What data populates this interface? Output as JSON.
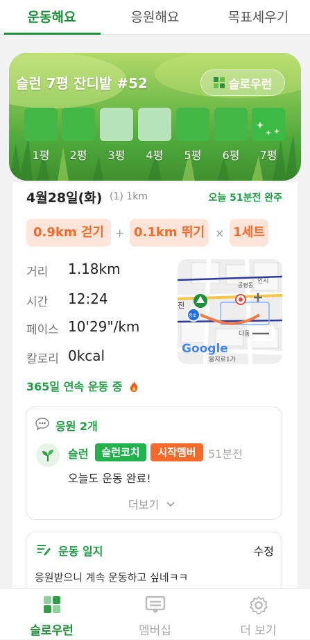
{
  "tabs": [
    {
      "label": "운동해요",
      "active": true
    },
    {
      "label": "응원해요",
      "active": false
    },
    {
      "label": "목표세우기",
      "active": false
    }
  ],
  "banner": {
    "title": "슬런 7평 잔디밭 #52",
    "brand": "슬로우런",
    "pyeong": [
      {
        "label": "1평",
        "state": "done"
      },
      {
        "label": "2평",
        "state": "done"
      },
      {
        "label": "3평",
        "state": "light"
      },
      {
        "label": "4평",
        "state": "light"
      },
      {
        "label": "5평",
        "state": "done"
      },
      {
        "label": "6평",
        "state": "done"
      },
      {
        "label": "7평",
        "state": "sparkle"
      }
    ]
  },
  "workout": {
    "date": "4월28일(화)",
    "subtitle": "(1) 1km",
    "status": "오늘 51분전 완주",
    "plan": {
      "walk": "0.9km 걷기",
      "plus": "+",
      "run": "0.1km 뛰기",
      "times": "×",
      "sets": "1세트"
    },
    "stats": [
      {
        "label": "거리",
        "value": "1.18km"
      },
      {
        "label": "시간",
        "value": "12:24"
      },
      {
        "label": "페이스",
        "value": "10'29\"/km"
      },
      {
        "label": "칼로리",
        "value": "0kcal"
      }
    ],
    "map": {
      "labels": [
        "인시",
        "공평동",
        "천",
        "다동",
        "을지로1가",
        "종로",
        "Google"
      ]
    },
    "streak": "365일 연속 운동 중"
  },
  "cheers": {
    "title": "응원 2개",
    "items": [
      {
        "name": "슬런",
        "badges": [
          "슬런코치",
          "시작멤버"
        ],
        "time": "51분전",
        "text": "오늘도 운동 완료!"
      }
    ],
    "more": "더보기"
  },
  "log": {
    "title": "운동 일지",
    "edit": "수정",
    "text": "응원받으니 계속 운동하고 싶네ㅋㅋ"
  },
  "bottom_nav": [
    {
      "label": "슬로우런",
      "active": true,
      "icon": "grid-icon"
    },
    {
      "label": "멤버십",
      "active": false,
      "icon": "membership-icon"
    },
    {
      "label": "더 보기",
      "active": false,
      "icon": "gear-icon"
    }
  ],
  "colors": {
    "accent": "#1f9e44",
    "orange": "#f36a2a",
    "chip_bg": "#fde5d9",
    "badge_green": "#22b14c",
    "badge_orange": "#f36a2a"
  }
}
